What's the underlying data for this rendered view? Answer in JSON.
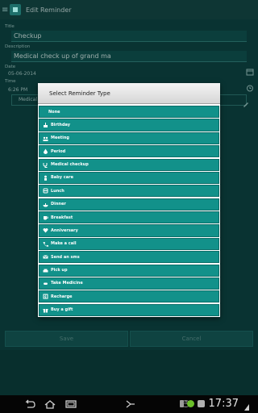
{
  "app": {
    "title": "Edit Reminder"
  },
  "form": {
    "title_label": "Title",
    "title_value": "Checkup",
    "description_label": "Description",
    "description_value": "Medical check up of grand ma",
    "date_label": "Date",
    "date_value": "05-06-2014",
    "time_label": "Time",
    "time_value": "6:26 PM",
    "type_value": "Medical"
  },
  "buttons": {
    "save": "Save",
    "cancel": "Cancel"
  },
  "dialog": {
    "title": "Select Reminder Type",
    "options": [
      {
        "label": "None",
        "icon": "none"
      },
      {
        "label": "Birthday",
        "icon": "cake-icon"
      },
      {
        "label": "Meeting",
        "icon": "meeting-icon"
      },
      {
        "label": "Period",
        "icon": "drop-icon"
      },
      {
        "label": "Medical checkup",
        "icon": "stethoscope-icon"
      },
      {
        "label": "Baby care",
        "icon": "baby-icon"
      },
      {
        "label": "Lunch",
        "icon": "lunch-icon"
      },
      {
        "label": "Dinner",
        "icon": "dinner-icon"
      },
      {
        "label": "Breakfast",
        "icon": "breakfast-icon"
      },
      {
        "label": "Anniversary",
        "icon": "heart-icon"
      },
      {
        "label": "Make a call",
        "icon": "phone-icon"
      },
      {
        "label": "Send an sms",
        "icon": "envelope-icon"
      },
      {
        "label": "Pick up",
        "icon": "car-icon"
      },
      {
        "label": "Take Medicine",
        "icon": "pill-icon"
      },
      {
        "label": "Recharge",
        "icon": "recharge-icon"
      },
      {
        "label": "Buy a gift",
        "icon": "gift-icon"
      }
    ]
  },
  "status": {
    "time": "17:37",
    "battery_badge": "100"
  },
  "colors": {
    "accent": "#12918a",
    "background": "#0d4543"
  }
}
